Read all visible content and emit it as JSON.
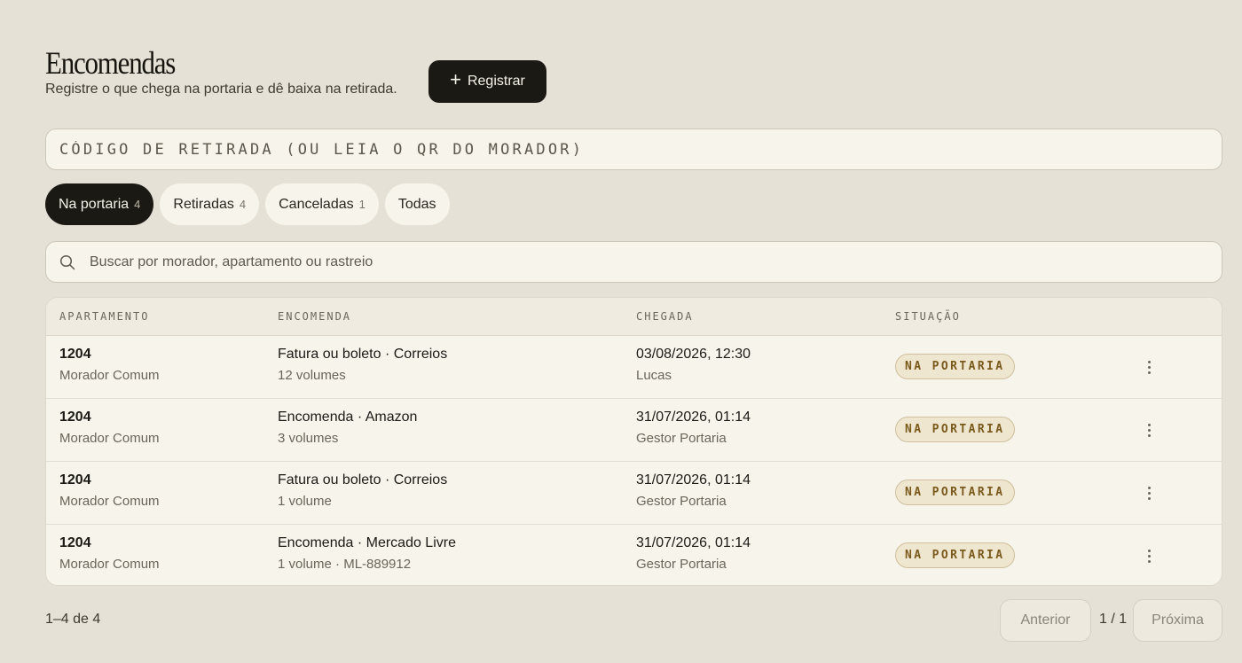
{
  "header": {
    "title": "Encomendas",
    "subtitle": "Registre o que chega na portaria e dê baixa na retirada.",
    "register_label": "Registrar"
  },
  "code_input": {
    "placeholder": "CÓDIGO DE RETIRADA (OU LEIA O QR DO MORADOR)"
  },
  "tabs": [
    {
      "label": "Na portaria",
      "count": "4",
      "active": true
    },
    {
      "label": "Retiradas",
      "count": "4",
      "active": false
    },
    {
      "label": "Canceladas",
      "count": "1",
      "active": false
    },
    {
      "label": "Todas",
      "count": "",
      "active": false
    }
  ],
  "search": {
    "placeholder": "Buscar por morador, apartamento ou rastreio"
  },
  "table": {
    "columns": [
      "APARTAMENTO",
      "ENCOMENDA",
      "CHEGADA",
      "SITUAÇÃO"
    ],
    "rows": [
      {
        "apartment": "1204",
        "resident": "Morador Comum",
        "package": "Fatura ou boleto · Correios",
        "volumes": "12 volumes",
        "arrival": "03/08/2026, 12:30",
        "received_by": "Lucas",
        "status": "NA PORTARIA"
      },
      {
        "apartment": "1204",
        "resident": "Morador Comum",
        "package": "Encomenda · Amazon",
        "volumes": "3 volumes",
        "arrival": "31/07/2026, 01:14",
        "received_by": "Gestor Portaria",
        "status": "NA PORTARIA"
      },
      {
        "apartment": "1204",
        "resident": "Morador Comum",
        "package": "Fatura ou boleto · Correios",
        "volumes": "1 volume",
        "arrival": "31/07/2026, 01:14",
        "received_by": "Gestor Portaria",
        "status": "NA PORTARIA"
      },
      {
        "apartment": "1204",
        "resident": "Morador Comum",
        "package": "Encomenda · Mercado Livre",
        "volumes": "1 volume · ML-889912",
        "arrival": "31/07/2026, 01:14",
        "received_by": "Gestor Portaria",
        "status": "NA PORTARIA"
      }
    ]
  },
  "pagination": {
    "range": "1–4 de 4",
    "prev_label": "Anterior",
    "page": "1 / 1",
    "next_label": "Próxima"
  },
  "colors": {
    "background": "#e6e1d7",
    "surface": "#f7f4ec",
    "primary_dark": "#1b1913",
    "badge_bg": "#efe6d0",
    "badge_text": "#7a5a1c"
  }
}
